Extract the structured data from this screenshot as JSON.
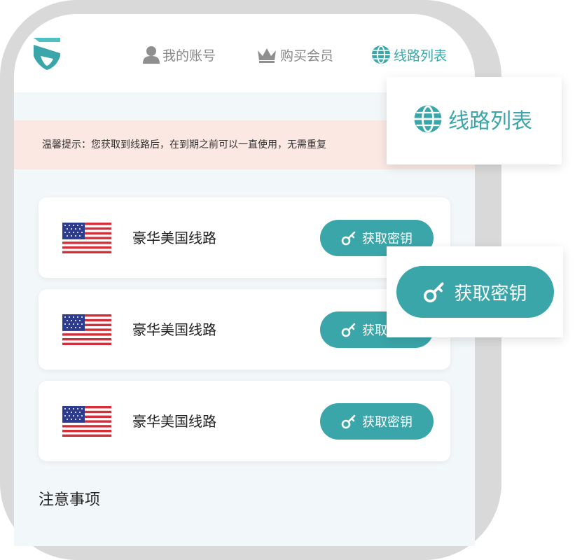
{
  "nav": {
    "account": "我的账号",
    "buy_vip": "购买会员",
    "lines": "线路列表"
  },
  "notice": "温馨提示：您获取到线路后，在到期之前可以一直使用，无需重复",
  "lines": [
    {
      "name": "豪华美国线路",
      "button": "获取密钥",
      "flag": "us-flag-icon"
    },
    {
      "name": "豪华美国线路",
      "button": "获取密钥",
      "flag": "us-flag-icon"
    },
    {
      "name": "豪华美国线路",
      "button": "获取密钥",
      "flag": "us-flag-icon"
    }
  ],
  "notes_title": "注意事项",
  "callouts": {
    "lines_label": "线路列表",
    "key_label": "获取密钥"
  },
  "colors": {
    "accent": "#3aa6aa",
    "notice_bg": "#fbe8e3",
    "screen_bg": "#f2f7f9",
    "frame": "#d9d9d9"
  }
}
